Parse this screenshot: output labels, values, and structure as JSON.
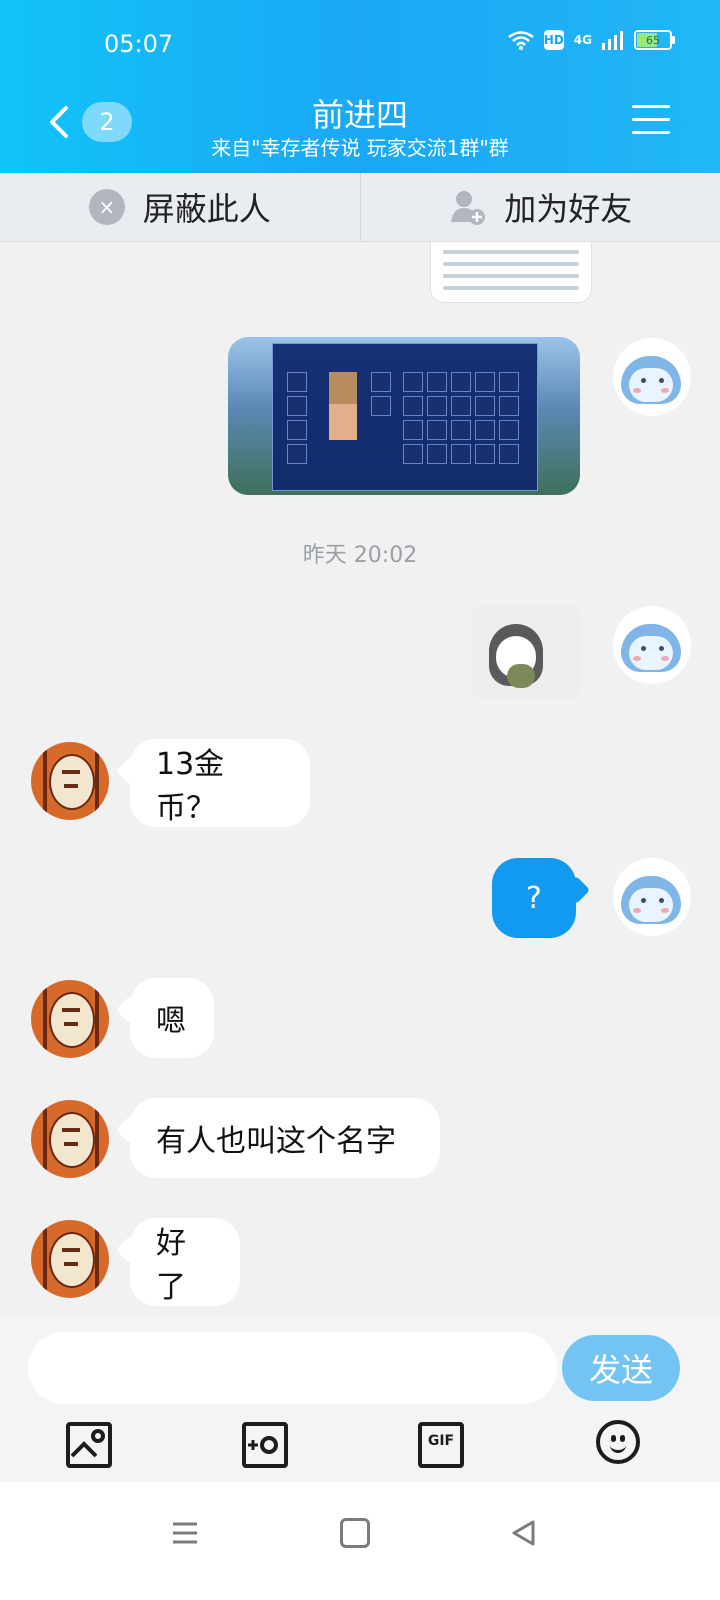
{
  "status_bar": {
    "time": "05:07",
    "wifi_icon": "wifi-icon",
    "hd_label": "HD",
    "network_label": "4G",
    "battery_level": "65"
  },
  "header": {
    "back_count": "2",
    "title": "前进四",
    "subtitle": "来自\"幸存者传说 玩家交流1群\"群"
  },
  "actions": {
    "block_label": "屏蔽此人",
    "add_friend_label": "加为好友"
  },
  "chat": {
    "timestamp": "昨天 20:02",
    "messages": [
      {
        "side": "left",
        "text": "13金币？"
      },
      {
        "side": "right",
        "text": "?"
      },
      {
        "side": "left",
        "text": "嗯"
      },
      {
        "side": "left",
        "text": "有人也叫这个名字"
      },
      {
        "side": "left",
        "text": "好了"
      }
    ]
  },
  "composer": {
    "input_value": "",
    "send_label": "发送",
    "gif_label": "GIF"
  }
}
